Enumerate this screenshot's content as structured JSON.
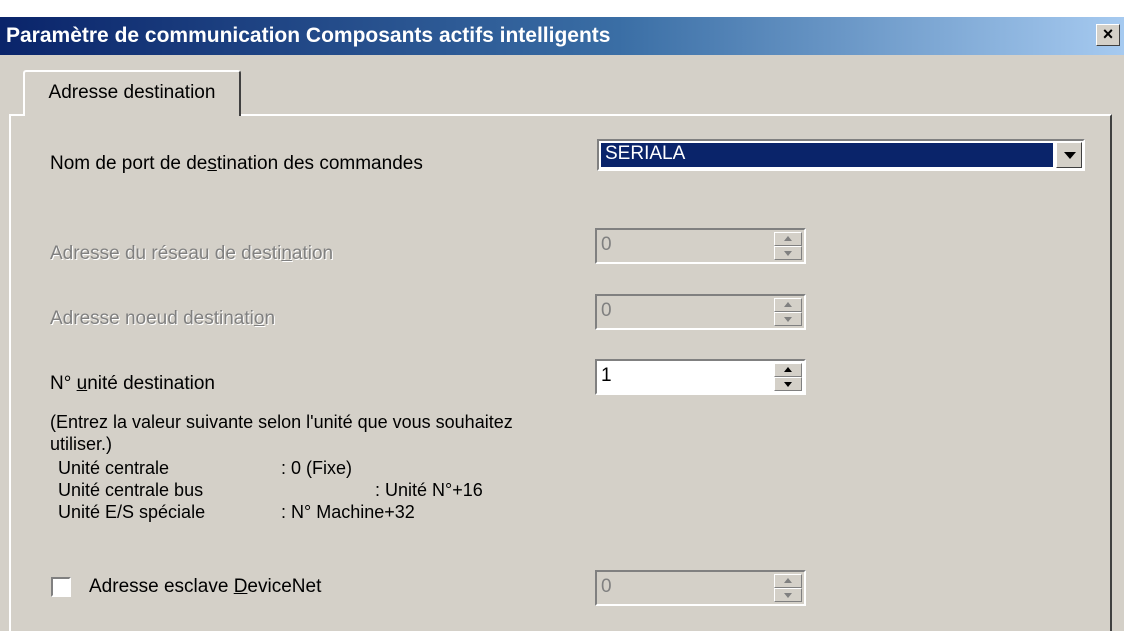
{
  "window": {
    "title": "Paramètre de communication Composants actifs intelligents",
    "close_label": "×"
  },
  "tabs": [
    {
      "label": "Adresse destination",
      "selected": true
    }
  ],
  "port": {
    "label_before": "Nom de port de de",
    "label_accel": "s",
    "label_after": "tination des commandes",
    "value": "SERIALA"
  },
  "network_address": {
    "label_before": "Adresse du réseau de desti",
    "label_accel": "n",
    "label_after": "ation",
    "value": "0",
    "enabled": false
  },
  "node_address": {
    "label_before": "Adresse noeud destinati",
    "label_accel": "o",
    "label_after": "n",
    "value": "0",
    "enabled": false
  },
  "unit_number": {
    "label_before": "N° ",
    "label_accel": "u",
    "label_after": "nité destination",
    "value": "1",
    "enabled": true
  },
  "help": {
    "intro": "(Entrez la valeur suivante selon l'unité que vous souhaitez utiliser.)",
    "rows": [
      {
        "name": "Unité centrale",
        "value": ": 0 (Fixe)"
      },
      {
        "name": "Unité centrale bus",
        "value": ": Unité N°+16"
      },
      {
        "name": "Unité E/S spéciale",
        "value": ": N° Machine+32"
      }
    ]
  },
  "devicenet": {
    "label_before": "Adresse esclave ",
    "label_accel": "D",
    "label_after": "eviceNet",
    "checked": false,
    "value": "0",
    "enabled": false
  }
}
